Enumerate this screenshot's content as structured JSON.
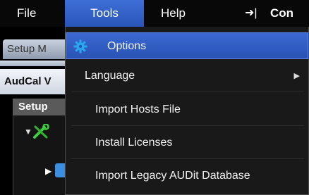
{
  "menubar": {
    "file": "File",
    "tools": "Tools",
    "help": "Help",
    "pin_glyph": "➜|",
    "truncated_label": "Con"
  },
  "background": {
    "tab_label": "Setup M",
    "panel_title": "AudCal V",
    "setup_header": "Setup"
  },
  "dropdown": {
    "items": [
      {
        "label": "Options",
        "icon": "gear-icon",
        "highlighted": true
      },
      {
        "label": "Language",
        "has_submenu": true
      },
      {
        "label": "Import Hosts File"
      },
      {
        "label": "Install Licenses"
      },
      {
        "label": "Import Legacy AUDit Database"
      }
    ]
  },
  "colors": {
    "highlight": "#2f5ec4",
    "menu_bg": "#191919",
    "gear_icon": "#29a8f0",
    "tools_icon": "#3ecf3e"
  }
}
